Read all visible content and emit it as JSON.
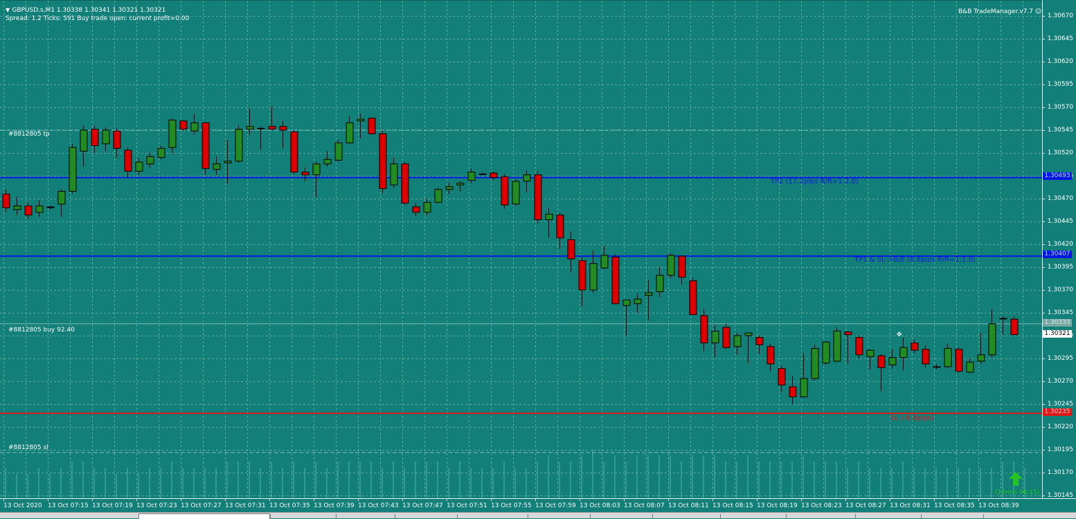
{
  "header": {
    "symbol_line": "GBPUSD.s,M1  1.30338 1.30341 1.30321 1.30321",
    "status_line": "Spread: 1.2   Ticks: 591   Buy trade open: current profit=0.00",
    "manager": "B&B TradeManager.v7.7",
    "smiley_icon": "smiley-icon"
  },
  "price_axis": {
    "labels": [
      "1.30670",
      "1.30645",
      "1.30620",
      "1.30595",
      "1.30570",
      "1.30545",
      "1.30520",
      "1.30495",
      "1.30470",
      "1.30445",
      "1.30420",
      "1.30395",
      "1.30370",
      "1.30345",
      "1.30320",
      "1.30295",
      "1.30270",
      "1.30245",
      "1.30220",
      "1.30195",
      "1.30170",
      "1.30145"
    ],
    "tags": {
      "tp2": "1.30493",
      "tp1": "1.30407",
      "entry": "1.30333",
      "bid": "1.30321",
      "sl": "1.30235"
    }
  },
  "lines": {
    "tp_label": "#8812805 tp",
    "buy_label": "#8812805 buy 92.40",
    "sl_label": "#8812805 sl",
    "tp2_text": "TP2 (17.2pips R/R=1:2.0)",
    "tp1_text": "TP1 & SL->B/E (8.6pips R/R=1:1.0)",
    "sl_text": "SL (-8.6pips)",
    "colors": {
      "tp": "#0018e0",
      "sl": "#e01818",
      "bull": "#228b22",
      "bear": "#dd0000"
    }
  },
  "signal": {
    "arrow_icon": "up-arrow-icon",
    "text": "(15min 08:15)"
  },
  "time_axis": {
    "labels": [
      "13 Oct 2020",
      "13 Oct 07:15",
      "13 Oct 07:19",
      "13 Oct 07:23",
      "13 Oct 07:27",
      "13 Oct 07:31",
      "13 Oct 07:35",
      "13 Oct 07:39",
      "13 Oct 07:43",
      "13 Oct 07:47",
      "13 Oct 07:51",
      "13 Oct 07:55",
      "13 Oct 07:59",
      "13 Oct 08:03",
      "13 Oct 08:07",
      "13 Oct 08:11",
      "13 Oct 08:15",
      "13 Oct 08:19",
      "13 Oct 08:23",
      "13 Oct 08:27",
      "13 Oct 08:31",
      "13 Oct 08:35",
      "13 Oct 08:39"
    ]
  },
  "chart_data": {
    "type": "candlestick",
    "symbol": "GBPUSD.s",
    "timeframe": "M1",
    "ylim": [
      1.30145,
      1.3068
    ],
    "grid": true,
    "candles": [
      {
        "o": 1.30475,
        "h": 1.3048,
        "l": 1.30455,
        "c": 1.3046
      },
      {
        "o": 1.30458,
        "h": 1.30472,
        "l": 1.30452,
        "c": 1.30462
      },
      {
        "o": 1.30462,
        "h": 1.30466,
        "l": 1.30448,
        "c": 1.30452
      },
      {
        "o": 1.30455,
        "h": 1.30468,
        "l": 1.3045,
        "c": 1.30462
      },
      {
        "o": 1.3046,
        "h": 1.30462,
        "l": 1.30458,
        "c": 1.30461
      },
      {
        "o": 1.30464,
        "h": 1.3048,
        "l": 1.3045,
        "c": 1.30478
      },
      {
        "o": 1.30478,
        "h": 1.3053,
        "l": 1.30475,
        "c": 1.30526
      },
      {
        "o": 1.30522,
        "h": 1.3055,
        "l": 1.30505,
        "c": 1.30545
      },
      {
        "o": 1.30546,
        "h": 1.3055,
        "l": 1.3052,
        "c": 1.30528
      },
      {
        "o": 1.3053,
        "h": 1.30548,
        "l": 1.30522,
        "c": 1.30545
      },
      {
        "o": 1.30544,
        "h": 1.30547,
        "l": 1.30515,
        "c": 1.30525
      },
      {
        "o": 1.30523,
        "h": 1.30526,
        "l": 1.30493,
        "c": 1.305
      },
      {
        "o": 1.305,
        "h": 1.30514,
        "l": 1.30496,
        "c": 1.3051
      },
      {
        "o": 1.30508,
        "h": 1.3052,
        "l": 1.30504,
        "c": 1.30516
      },
      {
        "o": 1.30515,
        "h": 1.30528,
        "l": 1.30513,
        "c": 1.30525
      },
      {
        "o": 1.30526,
        "h": 1.30558,
        "l": 1.3052,
        "c": 1.30556
      },
      {
        "o": 1.30555,
        "h": 1.30556,
        "l": 1.30544,
        "c": 1.30546
      },
      {
        "o": 1.30544,
        "h": 1.30563,
        "l": 1.3054,
        "c": 1.30553
      },
      {
        "o": 1.30553,
        "h": 1.30554,
        "l": 1.30496,
        "c": 1.30503
      },
      {
        "o": 1.30502,
        "h": 1.30516,
        "l": 1.30496,
        "c": 1.30508
      },
      {
        "o": 1.30509,
        "h": 1.30534,
        "l": 1.30486,
        "c": 1.30511
      },
      {
        "o": 1.30511,
        "h": 1.3055,
        "l": 1.30509,
        "c": 1.30546
      },
      {
        "o": 1.30546,
        "h": 1.30569,
        "l": 1.3054,
        "c": 1.30549
      },
      {
        "o": 1.30547,
        "h": 1.30549,
        "l": 1.30523,
        "c": 1.30547
      },
      {
        "o": 1.30549,
        "h": 1.30571,
        "l": 1.30545,
        "c": 1.30546
      },
      {
        "o": 1.30549,
        "h": 1.30555,
        "l": 1.30525,
        "c": 1.30545
      },
      {
        "o": 1.30543,
        "h": 1.30545,
        "l": 1.30497,
        "c": 1.30499
      },
      {
        "o": 1.30499,
        "h": 1.30504,
        "l": 1.30489,
        "c": 1.30496
      },
      {
        "o": 1.30496,
        "h": 1.3051,
        "l": 1.30471,
        "c": 1.30508
      },
      {
        "o": 1.30508,
        "h": 1.30522,
        "l": 1.30505,
        "c": 1.30513
      },
      {
        "o": 1.30512,
        "h": 1.30534,
        "l": 1.30511,
        "c": 1.30531
      },
      {
        "o": 1.30531,
        "h": 1.3056,
        "l": 1.3053,
        "c": 1.30553
      },
      {
        "o": 1.30555,
        "h": 1.30563,
        "l": 1.30536,
        "c": 1.30557
      },
      {
        "o": 1.30558,
        "h": 1.30559,
        "l": 1.3054,
        "c": 1.30541
      },
      {
        "o": 1.30541,
        "h": 1.30545,
        "l": 1.30476,
        "c": 1.30481
      },
      {
        "o": 1.30485,
        "h": 1.30515,
        "l": 1.30482,
        "c": 1.30508
      },
      {
        "o": 1.30508,
        "h": 1.3051,
        "l": 1.30463,
        "c": 1.30465
      },
      {
        "o": 1.30461,
        "h": 1.30465,
        "l": 1.30451,
        "c": 1.30455
      },
      {
        "o": 1.30455,
        "h": 1.3047,
        "l": 1.30452,
        "c": 1.30466
      },
      {
        "o": 1.30466,
        "h": 1.30482,
        "l": 1.30465,
        "c": 1.3048
      },
      {
        "o": 1.3048,
        "h": 1.30487,
        "l": 1.30475,
        "c": 1.30483
      },
      {
        "o": 1.30485,
        "h": 1.30489,
        "l": 1.30478,
        "c": 1.30487
      },
      {
        "o": 1.3049,
        "h": 1.30503,
        "l": 1.30487,
        "c": 1.30499
      },
      {
        "o": 1.30497,
        "h": 1.30499,
        "l": 1.30496,
        "c": 1.30497
      },
      {
        "o": 1.30498,
        "h": 1.305,
        "l": 1.3049,
        "c": 1.30493
      },
      {
        "o": 1.30494,
        "h": 1.30497,
        "l": 1.30459,
        "c": 1.30463
      },
      {
        "o": 1.30464,
        "h": 1.30491,
        "l": 1.30462,
        "c": 1.30489
      },
      {
        "o": 1.30489,
        "h": 1.30501,
        "l": 1.30477,
        "c": 1.30496
      },
      {
        "o": 1.30496,
        "h": 1.305,
        "l": 1.30443,
        "c": 1.30447
      },
      {
        "o": 1.30447,
        "h": 1.3046,
        "l": 1.30427,
        "c": 1.30453
      },
      {
        "o": 1.30452,
        "h": 1.30454,
        "l": 1.30415,
        "c": 1.30427
      },
      {
        "o": 1.30425,
        "h": 1.30434,
        "l": 1.30389,
        "c": 1.30404
      },
      {
        "o": 1.30402,
        "h": 1.30406,
        "l": 1.30352,
        "c": 1.3037
      },
      {
        "o": 1.3037,
        "h": 1.30413,
        "l": 1.30367,
        "c": 1.30399
      },
      {
        "o": 1.30394,
        "h": 1.30418,
        "l": 1.30393,
        "c": 1.30408
      },
      {
        "o": 1.30406,
        "h": 1.30409,
        "l": 1.30354,
        "c": 1.30355
      },
      {
        "o": 1.30353,
        "h": 1.30358,
        "l": 1.3032,
        "c": 1.30359
      },
      {
        "o": 1.30355,
        "h": 1.30366,
        "l": 1.30345,
        "c": 1.3036
      },
      {
        "o": 1.30364,
        "h": 1.30381,
        "l": 1.30337,
        "c": 1.30367
      },
      {
        "o": 1.30368,
        "h": 1.30395,
        "l": 1.30362,
        "c": 1.30386
      },
      {
        "o": 1.30386,
        "h": 1.3041,
        "l": 1.30383,
        "c": 1.30408
      },
      {
        "o": 1.30407,
        "h": 1.30408,
        "l": 1.30376,
        "c": 1.30384
      },
      {
        "o": 1.3038,
        "h": 1.30383,
        "l": 1.30342,
        "c": 1.30343
      },
      {
        "o": 1.30342,
        "h": 1.30349,
        "l": 1.30303,
        "c": 1.30312
      },
      {
        "o": 1.30312,
        "h": 1.30332,
        "l": 1.30296,
        "c": 1.30325
      },
      {
        "o": 1.30329,
        "h": 1.30333,
        "l": 1.30305,
        "c": 1.30307
      },
      {
        "o": 1.30308,
        "h": 1.30323,
        "l": 1.30299,
        "c": 1.3032
      },
      {
        "o": 1.3032,
        "h": 1.30322,
        "l": 1.3029,
        "c": 1.30323
      },
      {
        "o": 1.30318,
        "h": 1.3032,
        "l": 1.303,
        "c": 1.3031
      },
      {
        "o": 1.30308,
        "h": 1.30311,
        "l": 1.30281,
        "c": 1.30289
      },
      {
        "o": 1.30284,
        "h": 1.30287,
        "l": 1.30258,
        "c": 1.30266
      },
      {
        "o": 1.30264,
        "h": 1.30276,
        "l": 1.30245,
        "c": 1.30253
      },
      {
        "o": 1.30253,
        "h": 1.30301,
        "l": 1.30252,
        "c": 1.30273
      },
      {
        "o": 1.30273,
        "h": 1.3031,
        "l": 1.30271,
        "c": 1.30306
      },
      {
        "o": 1.3029,
        "h": 1.30314,
        "l": 1.30288,
        "c": 1.30313
      },
      {
        "o": 1.30292,
        "h": 1.30329,
        "l": 1.30291,
        "c": 1.30325
      },
      {
        "o": 1.30324,
        "h": 1.30325,
        "l": 1.30289,
        "c": 1.30321
      },
      {
        "o": 1.30318,
        "h": 1.3032,
        "l": 1.30295,
        "c": 1.30299
      },
      {
        "o": 1.30297,
        "h": 1.30305,
        "l": 1.30283,
        "c": 1.30304
      },
      {
        "o": 1.30298,
        "h": 1.303,
        "l": 1.30259,
        "c": 1.30285
      },
      {
        "o": 1.30288,
        "h": 1.30305,
        "l": 1.30284,
        "c": 1.30296
      },
      {
        "o": 1.30296,
        "h": 1.30318,
        "l": 1.30282,
        "c": 1.30307
      },
      {
        "o": 1.30312,
        "h": 1.30316,
        "l": 1.30301,
        "c": 1.30304
      },
      {
        "o": 1.30305,
        "h": 1.30309,
        "l": 1.30285,
        "c": 1.30289
      },
      {
        "o": 1.30286,
        "h": 1.30289,
        "l": 1.30283,
        "c": 1.30286
      },
      {
        "o": 1.30286,
        "h": 1.30311,
        "l": 1.30284,
        "c": 1.30306
      },
      {
        "o": 1.30305,
        "h": 1.30307,
        "l": 1.30279,
        "c": 1.30281
      },
      {
        "o": 1.3028,
        "h": 1.30295,
        "l": 1.30279,
        "c": 1.30291
      },
      {
        "o": 1.30292,
        "h": 1.30323,
        "l": 1.30289,
        "c": 1.30299
      },
      {
        "o": 1.30299,
        "h": 1.30349,
        "l": 1.30296,
        "c": 1.30333
      },
      {
        "o": 1.30339,
        "h": 1.30341,
        "l": 1.30321,
        "c": 1.30339
      },
      {
        "o": 1.30338,
        "h": 1.30341,
        "l": 1.30321,
        "c": 1.30321
      }
    ],
    "tick_volume": [
      5,
      4,
      4,
      5,
      4,
      5,
      6,
      6,
      5,
      5,
      4,
      5,
      4,
      5,
      5,
      6,
      5,
      5,
      5,
      5,
      6,
      6,
      6,
      5,
      6,
      5,
      6,
      5,
      6,
      5,
      6,
      6,
      6,
      6,
      5,
      6,
      5,
      6,
      6,
      6,
      5,
      6,
      5,
      5,
      5,
      6,
      5,
      5,
      6,
      7,
      6,
      6,
      7,
      8,
      6,
      7,
      6,
      7,
      7,
      7,
      7,
      6,
      7,
      7,
      7,
      6,
      6,
      7,
      6,
      6,
      6,
      6,
      7,
      6,
      6,
      6,
      5,
      6,
      5,
      5,
      5,
      6,
      5,
      5,
      5,
      5,
      5,
      5,
      5,
      5,
      6,
      6,
      5
    ],
    "levels": {
      "tp2": 1.30493,
      "tp1": 1.30407,
      "entry": 1.30333,
      "sl": 1.30235,
      "bid": 1.30321
    }
  }
}
